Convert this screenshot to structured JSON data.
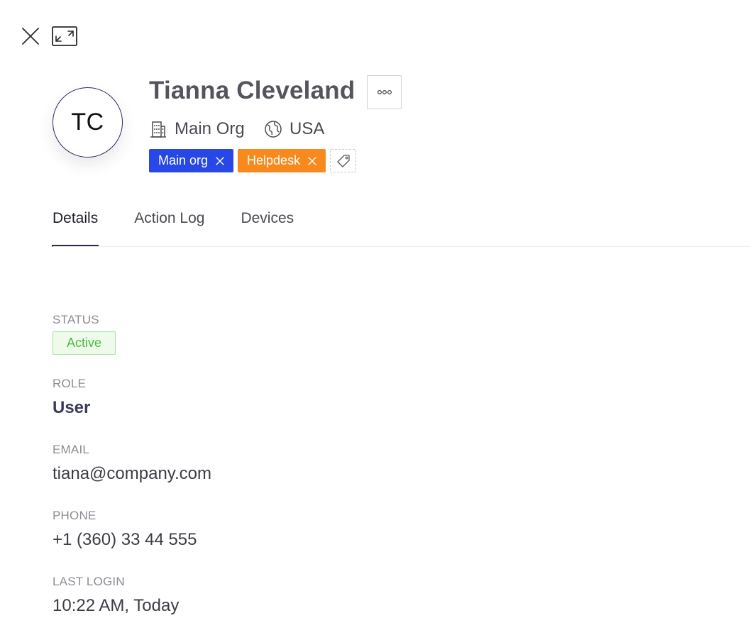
{
  "icons": {
    "close": "close-icon",
    "expand": "expand-icon",
    "more": "more-horizontal-icon",
    "organization": "building-icon",
    "country": "globe-icon",
    "add_tag": "tag-icon"
  },
  "profile": {
    "initials": "TC",
    "name": "Tianna Cleveland",
    "organization": "Main Org",
    "country": "USA"
  },
  "tags": [
    {
      "label": "Main org",
      "color": "#2748e6"
    },
    {
      "label": "Helpdesk",
      "color": "#f7891d"
    }
  ],
  "tabs": [
    {
      "label": "Details",
      "active": true
    },
    {
      "label": "Action Log",
      "active": false
    },
    {
      "label": "Devices",
      "active": false
    }
  ],
  "details": {
    "status": {
      "label": "STATUS",
      "value": "Active",
      "color": "#4bbd3f"
    },
    "role": {
      "label": "ROLE",
      "value": "User"
    },
    "email": {
      "label": "EMAIL",
      "value": "tiana@company.com"
    },
    "phone": {
      "label": "PHONE",
      "value": "+1 (360) 33 44 555"
    },
    "last_login": {
      "label": "LAST LOGIN",
      "value": "10:22 AM, Today"
    }
  }
}
